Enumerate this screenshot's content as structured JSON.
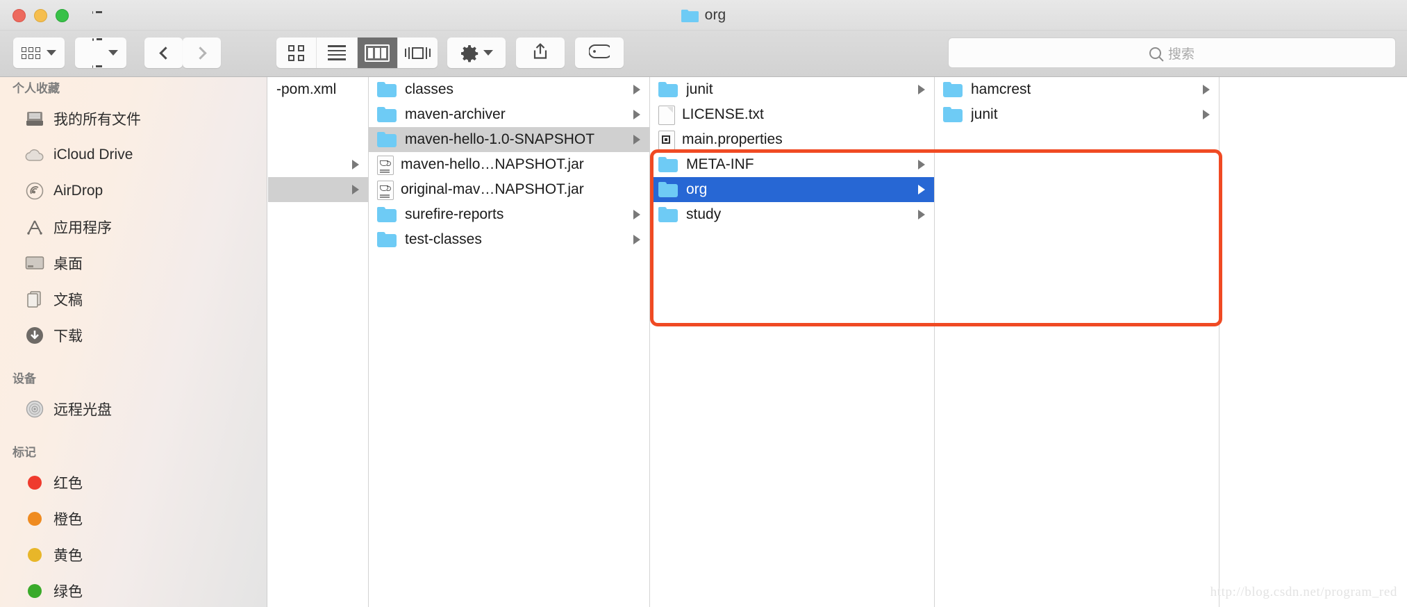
{
  "window": {
    "title": "org",
    "title_icon": "folder-icon",
    "traffic_lights": {
      "close": "close-button",
      "minimize": "minimize-button",
      "zoom": "zoom-button",
      "close_color": "#ed6a5e",
      "minimize_color": "#f5be4f",
      "zoom_color": "#38c148"
    }
  },
  "toolbar": {
    "arrange_label": "arrange-icon",
    "action_label": "action-icon",
    "back_label": "back-icon",
    "forward_label": "forward-icon",
    "view_modes": [
      {
        "name": "icon-view",
        "icon": "grid-icon",
        "active": false
      },
      {
        "name": "list-view",
        "icon": "rows-icon",
        "active": false
      },
      {
        "name": "column-view",
        "icon": "columns-icon",
        "active": true
      },
      {
        "name": "coverflow-view",
        "icon": "coverflow-icon",
        "active": false
      }
    ],
    "gear_label": "gear-icon",
    "share_label": "share-icon",
    "tag_label": "tag-icon"
  },
  "search": {
    "placeholder": "搜索",
    "value": "",
    "icon": "search-icon"
  },
  "sidebar": {
    "sections": [
      {
        "header": "个人收藏",
        "items": [
          {
            "label": "我的所有文件",
            "icon": "all-files-icon"
          },
          {
            "label": "iCloud Drive",
            "icon": "cloud-icon"
          },
          {
            "label": "AirDrop",
            "icon": "airdrop-icon"
          },
          {
            "label": "应用程序",
            "icon": "applications-icon"
          },
          {
            "label": "桌面",
            "icon": "desktop-icon"
          },
          {
            "label": "文稿",
            "icon": "documents-icon"
          },
          {
            "label": "下载",
            "icon": "downloads-icon"
          }
        ]
      },
      {
        "header": "设备",
        "items": [
          {
            "label": "远程光盘",
            "icon": "remote-disc-icon"
          }
        ]
      },
      {
        "header": "标记",
        "items": [
          {
            "label": "红色",
            "icon": "tag-dot-icon",
            "color": "#ef3b2d"
          },
          {
            "label": "橙色",
            "icon": "tag-dot-icon",
            "color": "#ef8b20"
          },
          {
            "label": "黄色",
            "icon": "tag-dot-icon",
            "color": "#e8b629"
          },
          {
            "label": "绿色",
            "icon": "tag-dot-icon",
            "color": "#3aaa2a"
          }
        ]
      }
    ]
  },
  "columns": [
    {
      "name": "column-1",
      "rows": [
        {
          "label": "-pom.xml",
          "type": "text-only",
          "arrow": false,
          "selected": "none"
        },
        {
          "label": "",
          "type": "blank",
          "arrow": false,
          "selected": "none"
        },
        {
          "label": "",
          "type": "blank",
          "arrow": false,
          "selected": "none"
        },
        {
          "label": "",
          "type": "blank",
          "arrow": true,
          "selected": "none"
        },
        {
          "label": "",
          "type": "blank",
          "arrow": true,
          "selected": "gray"
        }
      ]
    },
    {
      "name": "column-2",
      "rows": [
        {
          "label": "classes",
          "type": "folder",
          "arrow": true,
          "selected": "none"
        },
        {
          "label": "maven-archiver",
          "type": "folder",
          "arrow": true,
          "selected": "none"
        },
        {
          "label": "maven-hello-1.0-SNAPSHOT",
          "type": "folder",
          "arrow": true,
          "selected": "gray"
        },
        {
          "label": "maven-hello…NAPSHOT.jar",
          "type": "jar",
          "arrow": false,
          "selected": "none"
        },
        {
          "label": "original-mav…NAPSHOT.jar",
          "type": "jar",
          "arrow": false,
          "selected": "none"
        },
        {
          "label": "surefire-reports",
          "type": "folder",
          "arrow": true,
          "selected": "none"
        },
        {
          "label": "test-classes",
          "type": "folder",
          "arrow": true,
          "selected": "none"
        }
      ]
    },
    {
      "name": "column-3",
      "rows": [
        {
          "label": "junit",
          "type": "folder",
          "arrow": true,
          "selected": "none"
        },
        {
          "label": "LICENSE.txt",
          "type": "doc",
          "arrow": false,
          "selected": "none"
        },
        {
          "label": "main.properties",
          "type": "prop",
          "arrow": false,
          "selected": "none"
        },
        {
          "label": "META-INF",
          "type": "folder",
          "arrow": true,
          "selected": "none"
        },
        {
          "label": "org",
          "type": "folder",
          "arrow": true,
          "selected": "blue"
        },
        {
          "label": "study",
          "type": "folder",
          "arrow": true,
          "selected": "none"
        }
      ]
    },
    {
      "name": "column-4",
      "rows": [
        {
          "label": "hamcrest",
          "type": "folder",
          "arrow": true,
          "selected": "none"
        },
        {
          "label": "junit",
          "type": "folder",
          "arrow": true,
          "selected": "none"
        }
      ]
    }
  ],
  "annotation": {
    "name": "red-highlight-rectangle",
    "color": "#f04a23"
  },
  "watermark": {
    "text": "http://blog.csdn.net/program_red"
  }
}
